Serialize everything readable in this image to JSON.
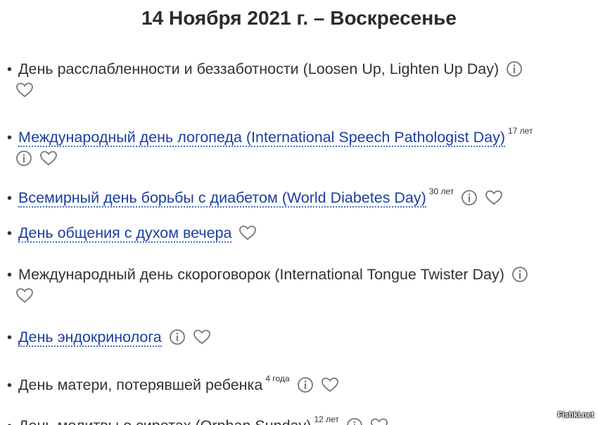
{
  "page": {
    "title": "14 Ноября 2021 г. – Воскресенье"
  },
  "bullet": "•",
  "holidays": [
    {
      "name": "День расслабленности и беззаботности (Loosen Up, Lighten Up Day)",
      "is_link": false,
      "years": "",
      "has_info": true
    },
    {
      "name": "Международный день логопеда (International Speech Pathologist Day)",
      "is_link": true,
      "years": "17 лет",
      "has_info": true
    },
    {
      "name": "Всемирный день борьбы с диабетом (World Diabetes Day)",
      "is_link": true,
      "years": "30 лет",
      "has_info": true
    },
    {
      "name": "День общения с духом вечера",
      "is_link": true,
      "years": "",
      "has_info": false
    },
    {
      "name": "Международный день скороговорок (International Tongue Twister Day)",
      "is_link": false,
      "years": "",
      "has_info": true
    },
    {
      "name": "День эндокринолога",
      "is_link": true,
      "years": "",
      "has_info": true
    },
    {
      "name": "День матери, потерявшей ребенка",
      "is_link": false,
      "years": "4 года",
      "has_info": true
    },
    {
      "name": "День молитвы о сиротах (Orphan Sunday)",
      "is_link": false,
      "years": "12 лет",
      "has_info": true
    }
  ],
  "watermark": "Fishki.net",
  "colors": {
    "text": "#333333",
    "link": "#1a3fa0",
    "icon": "#777777"
  },
  "icons": {
    "info": "info-circle-icon",
    "favorite": "heart-outline-icon"
  }
}
